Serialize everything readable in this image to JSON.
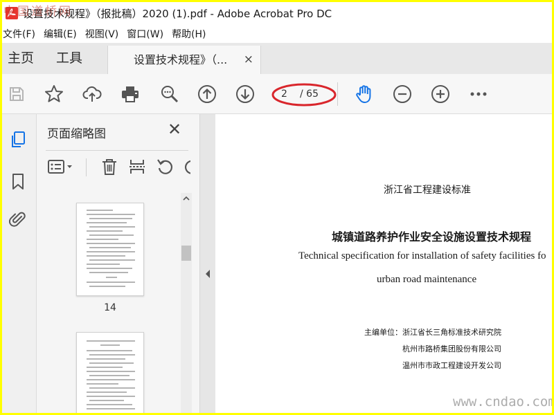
{
  "window": {
    "title": "设置技术规程》（报批稿）2020 (1).pdf - Adobe Acrobat Pro DC",
    "watermark_top": "中国道桥网",
    "watermark_bottom": "www.cndao.com"
  },
  "menu": [
    "文件(F)",
    "编辑(E)",
    "视图(V)",
    "窗口(W)",
    "帮助(H)"
  ],
  "tabs": {
    "home": "主页",
    "tools": "工具",
    "document": "设置技术规程》（...",
    "close_symbol": "×"
  },
  "toolbar": {
    "page_current": "2",
    "page_total": "/ 65",
    "icons": [
      "save-icon",
      "bookmark-star-icon",
      "upload-cloud-icon",
      "print-icon",
      "zoom-search-icon",
      "page-up-icon",
      "page-down-icon",
      "hand-tool-icon",
      "zoom-out-icon",
      "zoom-in-icon",
      "more-icon"
    ],
    "annotation_color": "#d9262c"
  },
  "left_rail": {
    "icons": [
      "page-thumbnails-icon",
      "bookmark-icon",
      "attachment-icon"
    ],
    "active_color": "#1473e6"
  },
  "thumbnails_panel": {
    "title": "页面缩略图",
    "close_symbol": "✕",
    "tools": [
      "thumbnail-options-icon",
      "delete-icon",
      "extract-icon",
      "rotate-icon"
    ],
    "thumbnails": [
      {
        "label": "14"
      }
    ]
  },
  "document": {
    "organization": "浙江省工程建设标准",
    "title_cn": "城镇道路养护作业安全设施设置技术规程",
    "title_en_line1": "Technical specification for installation of safety facilities fo",
    "title_en_line2": "urban road maintenance",
    "editor_label": "主编单位：",
    "editors": [
      "浙江省长三角标准技术研究院",
      "杭州市路桥集团股份有限公司",
      "温州市市政工程建设开发公司"
    ]
  }
}
